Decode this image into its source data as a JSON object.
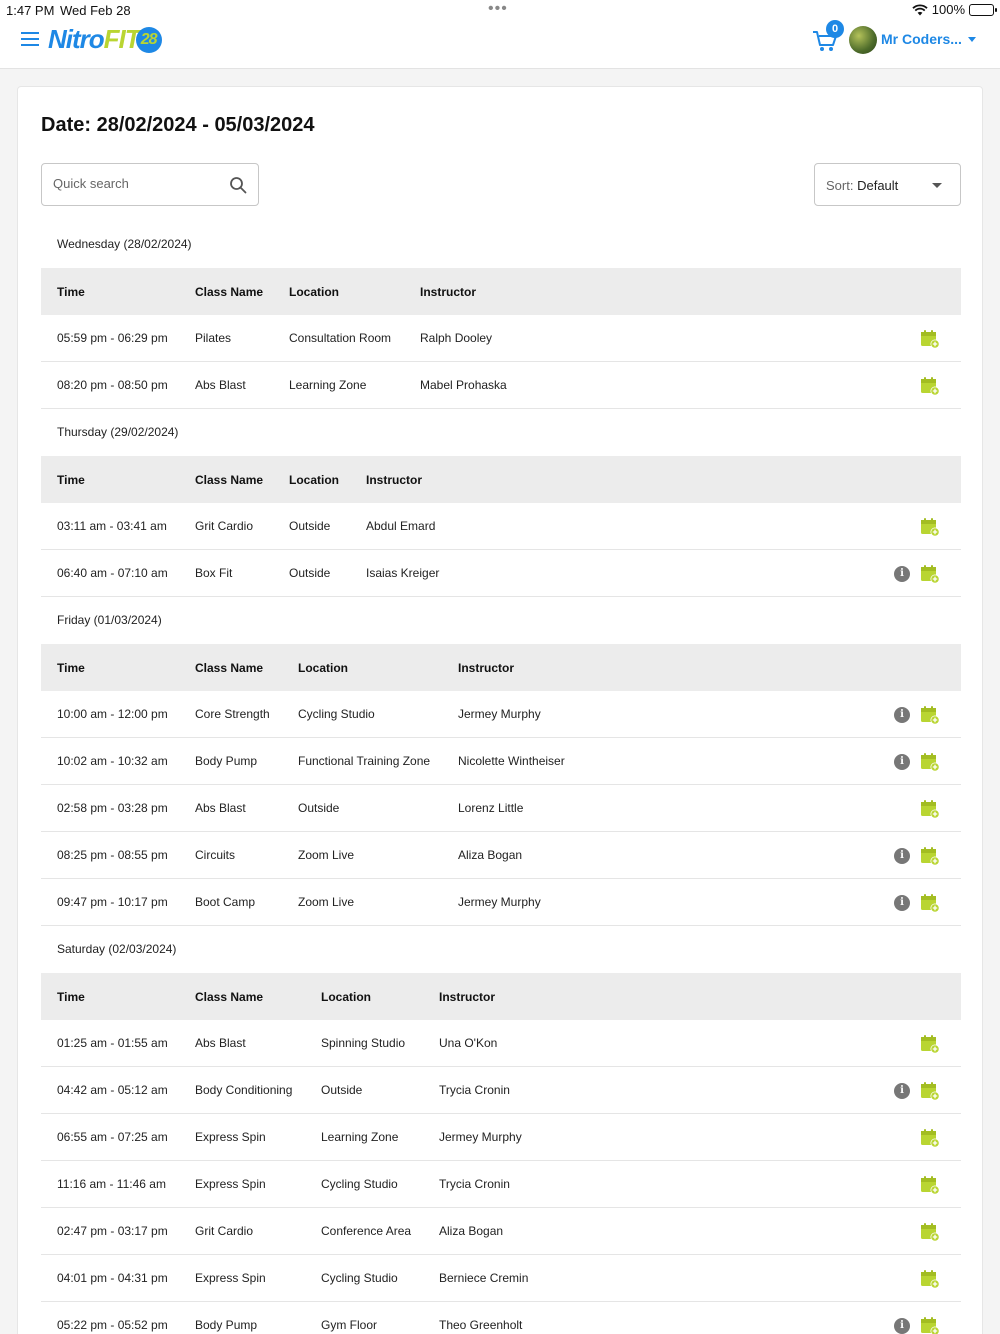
{
  "status_bar": {
    "time": "1:47 PM",
    "date": "Wed Feb 28",
    "battery": "100%"
  },
  "header": {
    "logo_nitro": "Nitro",
    "logo_fit": "FIT",
    "logo_badge": "28",
    "cart_count": "0",
    "username": "Mr Coders..."
  },
  "page": {
    "title": "Date: 28/02/2024 - 05/03/2024",
    "search_placeholder": "Quick search",
    "sort_label": "Sort:",
    "sort_value": "Default"
  },
  "columns": {
    "time": "Time",
    "class_name": "Class Name",
    "location": "Location",
    "instructor": "Instructor"
  },
  "accent_color": "#b9d532",
  "brand_color": "#1e88e5",
  "days": [
    {
      "label": "Wednesday (28/02/2024)",
      "classes": [
        {
          "time": "05:59 pm - 06:29 pm",
          "name": "Pilates",
          "location": "Consultation Room",
          "instructor": "Ralph Dooley",
          "info": false
        },
        {
          "time": "08:20 pm - 08:50 pm",
          "name": "Abs Blast",
          "location": "Learning Zone",
          "instructor": "Mabel Prohaska",
          "info": false
        }
      ]
    },
    {
      "label": "Thursday (29/02/2024)",
      "classes": [
        {
          "time": "03:11 am - 03:41 am",
          "name": "Grit Cardio",
          "location": "Outside",
          "instructor": "Abdul Emard",
          "info": false
        },
        {
          "time": "06:40 am - 07:10 am",
          "name": "Box Fit",
          "location": "Outside",
          "instructor": "Isaias Kreiger",
          "info": true
        }
      ]
    },
    {
      "label": "Friday (01/03/2024)",
      "classes": [
        {
          "time": "10:00 am - 12:00 pm",
          "name": "Core Strength",
          "location": "Cycling Studio",
          "instructor": "Jermey Murphy",
          "info": true
        },
        {
          "time": "10:02 am - 10:32 am",
          "name": "Body Pump",
          "location": "Functional Training Zone",
          "instructor": "Nicolette Wintheiser",
          "info": true
        },
        {
          "time": "02:58 pm - 03:28 pm",
          "name": "Abs Blast",
          "location": "Outside",
          "instructor": "Lorenz Little",
          "info": false
        },
        {
          "time": "08:25 pm - 08:55 pm",
          "name": "Circuits",
          "location": "Zoom Live",
          "instructor": "Aliza Bogan",
          "info": true
        },
        {
          "time": "09:47 pm - 10:17 pm",
          "name": "Boot Camp",
          "location": "Zoom Live",
          "instructor": "Jermey Murphy",
          "info": true
        }
      ]
    },
    {
      "label": "Saturday (02/03/2024)",
      "classes": [
        {
          "time": "01:25 am - 01:55 am",
          "name": "Abs Blast",
          "location": "Spinning Studio",
          "instructor": "Una O'Kon",
          "info": false
        },
        {
          "time": "04:42 am - 05:12 am",
          "name": "Body Conditioning",
          "location": "Outside",
          "instructor": "Trycia Cronin",
          "info": true
        },
        {
          "time": "06:55 am - 07:25 am",
          "name": "Express Spin",
          "location": "Learning Zone",
          "instructor": "Jermey Murphy",
          "info": false
        },
        {
          "time": "11:16 am - 11:46 am",
          "name": "Express Spin",
          "location": "Cycling Studio",
          "instructor": "Trycia Cronin",
          "info": false
        },
        {
          "time": "02:47 pm - 03:17 pm",
          "name": "Grit Cardio",
          "location": "Conference Area",
          "instructor": "Aliza Bogan",
          "info": false
        },
        {
          "time": "04:01 pm - 04:31 pm",
          "name": "Express Spin",
          "location": "Cycling Studio",
          "instructor": "Berniece Cremin",
          "info": false
        },
        {
          "time": "05:22 pm - 05:52 pm",
          "name": "Body Pump",
          "location": "Gym Floor",
          "instructor": "Theo Greenholt",
          "info": true
        }
      ]
    }
  ]
}
